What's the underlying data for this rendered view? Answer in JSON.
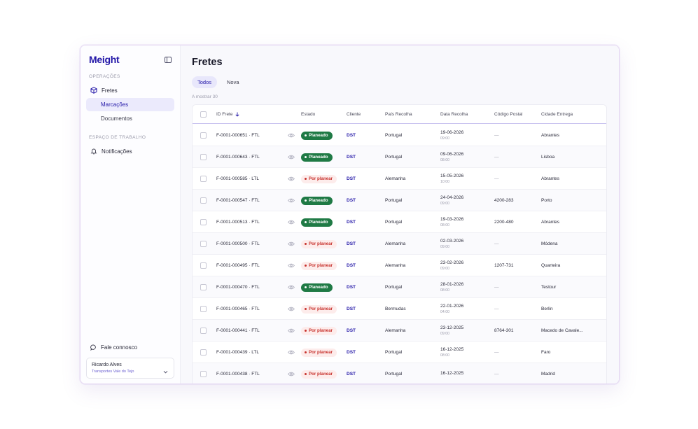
{
  "brand": "Meight",
  "sidebar": {
    "section_ops": "OPERAÇÕES",
    "fretes_label": "Fretes",
    "marcacoes_label": "Marcações",
    "documentos_label": "Documentos",
    "section_workspace": "ESPAÇO DE TRABALHO",
    "notificacoes_label": "Notificações",
    "contact_label": "Fale connosco",
    "user": {
      "name": "Ricardo Alves",
      "company": "Transportes Vale do Tejo"
    }
  },
  "main": {
    "title": "Fretes",
    "tabs": [
      {
        "label": "Todos"
      },
      {
        "label": "Nova"
      }
    ],
    "count_text": "A mostrar 30"
  },
  "table": {
    "columns": [
      "ID Frete",
      "Estado",
      "Cliente",
      "País Recolha",
      "Data Recolha",
      "Código Postal",
      "Cidade Entrega"
    ],
    "rows": [
      {
        "id": "F-0001-000651 · FTL",
        "status": "Planeado",
        "client": "DST",
        "country": "Portugal",
        "date": "19-06-2026",
        "time": "09:00",
        "postal": "—",
        "city": "Abrantes"
      },
      {
        "id": "F-0001-000643 · FTL",
        "status": "Planeado",
        "client": "DST",
        "country": "Portugal",
        "date": "09-06-2026",
        "time": "08:00",
        "postal": "—",
        "city": "Lisboa"
      },
      {
        "id": "F-0001-000585 · LTL",
        "status": "Por planear",
        "client": "DST",
        "country": "Alemanha",
        "date": "15-05-2026",
        "time": "10:00",
        "postal": "—",
        "city": "Abrantes"
      },
      {
        "id": "F-0001-000547 · FTL",
        "status": "Planeado",
        "client": "DST",
        "country": "Portugal",
        "date": "24-04-2026",
        "time": "09:00",
        "postal": "4200-283",
        "city": "Porto"
      },
      {
        "id": "F-0001-000513 · FTL",
        "status": "Planeado",
        "client": "DST",
        "country": "Portugal",
        "date": "19-03-2026",
        "time": "08:00",
        "postal": "2200-480",
        "city": "Abrantes"
      },
      {
        "id": "F-0001-000500 · FTL",
        "status": "Por planear",
        "client": "DST",
        "country": "Alemanha",
        "date": "02-03-2026",
        "time": "09:00",
        "postal": "—",
        "city": "Módena"
      },
      {
        "id": "F-0001-000495 · FTL",
        "status": "Por planear",
        "client": "DST",
        "country": "Alemanha",
        "date": "23-02-2026",
        "time": "09:00",
        "postal": "1207-731",
        "city": "Quarteira"
      },
      {
        "id": "F-0001-000470 · FTL",
        "status": "Planeado",
        "client": "DST",
        "country": "Portugal",
        "date": "28-01-2026",
        "time": "08:00",
        "postal": "—",
        "city": "Testour"
      },
      {
        "id": "F-0001-000465 · FTL",
        "status": "Por planear",
        "client": "DST",
        "country": "Bermudas",
        "date": "22-01-2026",
        "time": "04:00",
        "postal": "—",
        "city": "Berlin"
      },
      {
        "id": "F-0001-000441 · FTL",
        "status": "Por planear",
        "client": "DST",
        "country": "Alemanha",
        "date": "23-12-2025",
        "time": "09:00",
        "postal": "8764-301",
        "city": "Macedo de Cavale..."
      },
      {
        "id": "F-0001-000439 · LTL",
        "status": "Por planear",
        "client": "DST",
        "country": "Portugal",
        "date": "16-12-2025",
        "time": "08:00",
        "postal": "—",
        "city": "Faro"
      },
      {
        "id": "F-0001-000438 · FTL",
        "status": "Por planear",
        "client": "DST",
        "country": "Portugal",
        "date": "16-12-2025",
        "time": "",
        "postal": "—",
        "city": "Madrid"
      }
    ]
  },
  "colors": {
    "accent": "#2418a8",
    "planeado_bg": "#1f7a45",
    "planeado_fg": "#ffffff",
    "por_planear_bg": "#fdeceb",
    "por_planear_fg": "#c8332e"
  },
  "icons": {
    "collapse": "sidebar-collapse-icon",
    "fretes": "box-icon",
    "notificacoes": "bell-icon",
    "contact": "chat-bubble-icon",
    "sort": "arrow-down-icon",
    "view": "eye-icon",
    "user_menu": "chevron-down-icon"
  }
}
